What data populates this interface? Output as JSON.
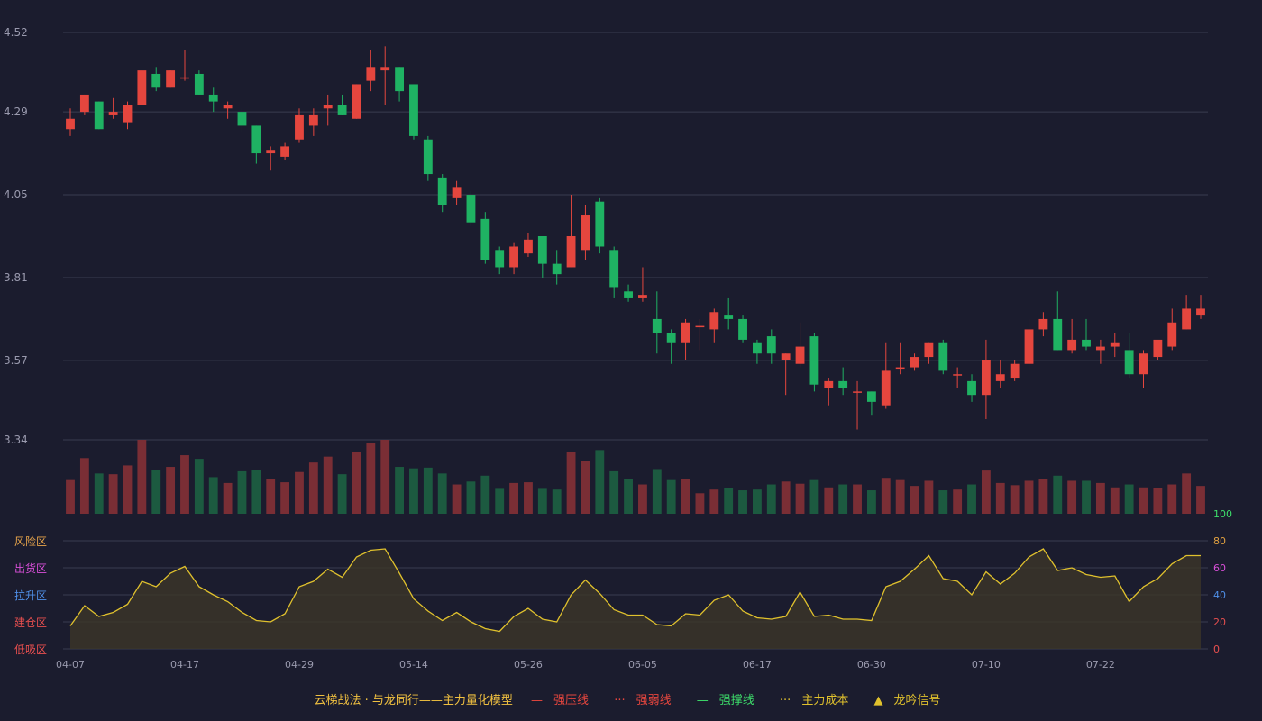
{
  "chart_data": {
    "type": "candlestick",
    "price_axis": {
      "ticks": [
        "4.52",
        "4.29",
        "4.05",
        "3.81",
        "3.57",
        "3.34"
      ],
      "ylim": [
        3.34,
        4.52
      ]
    },
    "osc_axis": {
      "ticks": [
        "100",
        "80",
        "60",
        "40",
        "20",
        "0"
      ],
      "ylim": [
        0,
        100
      ]
    },
    "zones": [
      {
        "label": "风险区",
        "color": "#e8a54b"
      },
      {
        "label": "出货区",
        "color": "#d94fd9"
      },
      {
        "label": "拉升区",
        "color": "#4f8fe8"
      },
      {
        "label": "建仓区",
        "color": "#e84f4f"
      },
      {
        "label": "低吸区",
        "color": "#e84f4f"
      }
    ],
    "x_labels": [
      {
        "i": 0,
        "t": "04-07"
      },
      {
        "i": 8,
        "t": "04-17"
      },
      {
        "i": 16,
        "t": "04-29"
      },
      {
        "i": 24,
        "t": "05-14"
      },
      {
        "i": 32,
        "t": "05-26"
      },
      {
        "i": 40,
        "t": "06-05"
      },
      {
        "i": 48,
        "t": "06-17"
      },
      {
        "i": 56,
        "t": "06-30"
      },
      {
        "i": 64,
        "t": "07-10"
      },
      {
        "i": 72,
        "t": "07-22"
      }
    ],
    "colors": {
      "up": "#e5463e",
      "down": "#1fb263",
      "vol_up": "#7a2e35",
      "vol_down": "#1c5a40",
      "line": "#e0c12d",
      "grid": "#3a3c50",
      "axis_text": "#9a9aae"
    },
    "ohlc": [
      [
        4.24,
        4.3,
        4.22,
        4.27
      ],
      [
        4.29,
        4.34,
        4.28,
        4.34
      ],
      [
        4.32,
        4.32,
        4.24,
        4.24
      ],
      [
        4.28,
        4.33,
        4.27,
        4.29
      ],
      [
        4.26,
        4.32,
        4.24,
        4.31
      ],
      [
        4.31,
        4.41,
        4.31,
        4.41
      ],
      [
        4.4,
        4.42,
        4.35,
        4.36
      ],
      [
        4.36,
        4.41,
        4.36,
        4.41
      ],
      [
        4.39,
        4.47,
        4.38,
        4.39
      ],
      [
        4.4,
        4.41,
        4.34,
        4.34
      ],
      [
        4.34,
        4.36,
        4.29,
        4.32
      ],
      [
        4.3,
        4.32,
        4.27,
        4.31
      ],
      [
        4.29,
        4.3,
        4.23,
        4.25
      ],
      [
        4.25,
        4.25,
        4.14,
        4.17
      ],
      [
        4.17,
        4.19,
        4.12,
        4.18
      ],
      [
        4.16,
        4.2,
        4.15,
        4.19
      ],
      [
        4.21,
        4.3,
        4.2,
        4.28
      ],
      [
        4.25,
        4.3,
        4.22,
        4.28
      ],
      [
        4.3,
        4.34,
        4.25,
        4.31
      ],
      [
        4.31,
        4.34,
        4.28,
        4.28
      ],
      [
        4.27,
        4.37,
        4.27,
        4.37
      ],
      [
        4.38,
        4.47,
        4.35,
        4.42
      ],
      [
        4.41,
        4.48,
        4.31,
        4.42
      ],
      [
        4.42,
        4.42,
        4.32,
        4.35
      ],
      [
        4.37,
        4.37,
        4.21,
        4.22
      ],
      [
        4.21,
        4.22,
        4.09,
        4.11
      ],
      [
        4.1,
        4.11,
        4.0,
        4.02
      ],
      [
        4.04,
        4.09,
        4.02,
        4.07
      ],
      [
        4.05,
        4.06,
        3.96,
        3.97
      ],
      [
        3.98,
        4.0,
        3.85,
        3.86
      ],
      [
        3.89,
        3.9,
        3.82,
        3.84
      ],
      [
        3.84,
        3.91,
        3.82,
        3.9
      ],
      [
        3.88,
        3.94,
        3.87,
        3.92
      ],
      [
        3.93,
        3.93,
        3.81,
        3.85
      ],
      [
        3.85,
        3.89,
        3.79,
        3.82
      ],
      [
        3.84,
        4.05,
        3.84,
        3.93
      ],
      [
        3.89,
        4.02,
        3.86,
        3.99
      ],
      [
        4.03,
        4.04,
        3.88,
        3.9
      ],
      [
        3.89,
        3.9,
        3.75,
        3.78
      ],
      [
        3.77,
        3.79,
        3.74,
        3.75
      ],
      [
        3.75,
        3.84,
        3.74,
        3.76
      ],
      [
        3.69,
        3.77,
        3.59,
        3.65
      ],
      [
        3.65,
        3.66,
        3.56,
        3.62
      ],
      [
        3.62,
        3.69,
        3.57,
        3.68
      ],
      [
        3.67,
        3.69,
        3.6,
        3.67
      ],
      [
        3.66,
        3.72,
        3.62,
        3.71
      ],
      [
        3.7,
        3.75,
        3.66,
        3.69
      ],
      [
        3.69,
        3.7,
        3.62,
        3.63
      ],
      [
        3.62,
        3.63,
        3.56,
        3.59
      ],
      [
        3.64,
        3.66,
        3.56,
        3.59
      ],
      [
        3.57,
        3.59,
        3.47,
        3.59
      ],
      [
        3.56,
        3.68,
        3.55,
        3.61
      ],
      [
        3.64,
        3.65,
        3.48,
        3.5
      ],
      [
        3.49,
        3.52,
        3.44,
        3.51
      ],
      [
        3.51,
        3.55,
        3.47,
        3.49
      ],
      [
        3.48,
        3.51,
        3.37,
        3.48
      ],
      [
        3.48,
        3.48,
        3.41,
        3.45
      ],
      [
        3.44,
        3.62,
        3.43,
        3.54
      ],
      [
        3.55,
        3.62,
        3.53,
        3.55
      ],
      [
        3.55,
        3.59,
        3.54,
        3.58
      ],
      [
        3.58,
        3.62,
        3.56,
        3.62
      ],
      [
        3.62,
        3.63,
        3.53,
        3.54
      ],
      [
        3.53,
        3.55,
        3.49,
        3.53
      ],
      [
        3.51,
        3.53,
        3.45,
        3.47
      ],
      [
        3.47,
        3.63,
        3.4,
        3.57
      ],
      [
        3.51,
        3.57,
        3.49,
        3.53
      ],
      [
        3.52,
        3.57,
        3.51,
        3.56
      ],
      [
        3.56,
        3.69,
        3.54,
        3.66
      ],
      [
        3.66,
        3.71,
        3.64,
        3.69
      ],
      [
        3.69,
        3.77,
        3.6,
        3.6
      ],
      [
        3.6,
        3.69,
        3.59,
        3.63
      ],
      [
        3.63,
        3.69,
        3.6,
        3.61
      ],
      [
        3.6,
        3.63,
        3.56,
        3.61
      ],
      [
        3.61,
        3.65,
        3.58,
        3.62
      ],
      [
        3.6,
        3.65,
        3.52,
        3.53
      ],
      [
        3.53,
        3.6,
        3.49,
        3.59
      ],
      [
        3.58,
        3.62,
        3.57,
        3.63
      ],
      [
        3.61,
        3.72,
        3.6,
        3.68
      ],
      [
        3.66,
        3.76,
        3.66,
        3.72
      ],
      [
        3.7,
        3.76,
        3.69,
        3.72
      ]
    ],
    "volume": [
      46,
      76,
      55,
      54,
      66,
      101,
      60,
      64,
      80,
      75,
      50,
      42,
      58,
      60,
      47,
      43,
      57,
      70,
      78,
      54,
      85,
      97,
      101,
      64,
      62,
      63,
      55,
      40,
      44,
      52,
      34,
      42,
      43,
      34,
      33,
      85,
      72,
      87,
      58,
      47,
      40,
      61,
      46,
      47,
      28,
      33,
      35,
      32,
      33,
      40,
      44,
      41,
      46,
      36,
      40,
      40,
      32,
      49,
      46,
      38,
      45,
      32,
      33,
      40,
      59,
      42,
      39,
      45,
      48,
      52,
      45,
      45,
      42,
      36,
      40,
      36,
      35,
      40,
      55,
      38
    ],
    "oscillator": [
      17,
      32,
      24,
      27,
      33,
      50,
      46,
      56,
      61,
      46,
      40,
      35,
      27,
      21,
      20,
      26,
      46,
      50,
      59,
      53,
      68,
      73,
      74,
      56,
      37,
      28,
      21,
      27,
      20,
      15,
      13,
      24,
      30,
      22,
      20,
      40,
      51,
      41,
      29,
      25,
      25,
      18,
      17,
      26,
      25,
      36,
      40,
      28,
      23,
      22,
      24,
      42,
      24,
      25,
      22,
      22,
      21,
      46,
      50,
      59,
      69,
      52,
      50,
      40,
      57,
      48,
      56,
      68,
      74,
      58,
      60,
      55,
      53,
      54,
      35,
      46,
      52,
      63,
      69,
      69
    ]
  },
  "legend": {
    "title": "云梯战法 · 与龙同行——主力量化模型",
    "items": [
      {
        "label": "强压线",
        "color": "#e5463e",
        "mark": "—"
      },
      {
        "label": "强弱线",
        "color": "#e5463e",
        "mark": "···"
      },
      {
        "label": "强撑线",
        "color": "#3ddc6a",
        "mark": "—"
      },
      {
        "label": "主力成本",
        "color": "#e0c12d",
        "mark": "···"
      },
      {
        "label": "龙吟信号",
        "color": "#e0c12d",
        "mark": "▲"
      }
    ]
  }
}
